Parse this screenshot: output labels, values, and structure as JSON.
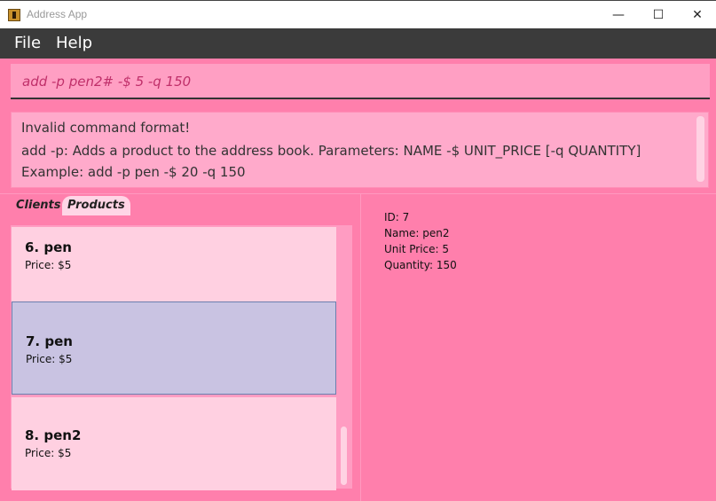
{
  "window": {
    "title": "Address App",
    "controls": {
      "minimize": "—",
      "maximize": "☐",
      "close": "✕"
    }
  },
  "menu": {
    "items": [
      "File",
      "Help"
    ]
  },
  "command": {
    "value": "add -p pen2# -$ 5 -q 150"
  },
  "result": {
    "lines": [
      "Invalid command format!",
      "add -p: Adds a product to the address book. Parameters: NAME -$ UNIT_PRICE [-q QUANTITY]",
      "Example: add -p pen -$ 20 -q 150"
    ]
  },
  "tabs": [
    "Clients",
    "Products"
  ],
  "active_tab": "Products",
  "products": [
    {
      "name": "6.  pen",
      "price": "Price: $5"
    },
    {
      "name": "7.  pen",
      "price": "Price: $5",
      "selected": true
    },
    {
      "name": "8.  pen2",
      "price": "Price: $5"
    }
  ],
  "detail": {
    "id": "ID: 7",
    "name": "Name: pen2",
    "unit_price": "Unit Price: 5",
    "quantity": "Quantity: 150"
  },
  "colors": {
    "background": "#ff7fac",
    "command_box": "#ff9fc3",
    "card": "#ffd0e1",
    "selected_card": "#c9c3e2",
    "menubar": "#3b3b3b"
  }
}
